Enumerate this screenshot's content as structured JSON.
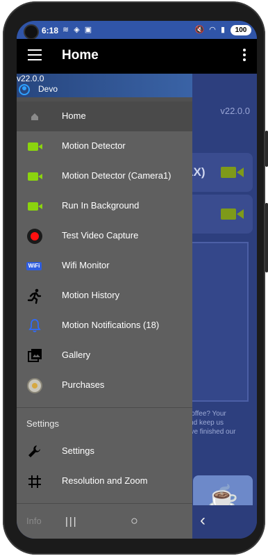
{
  "status_bar": {
    "time": "6:18",
    "left_icons": "≋ ◈ ▣",
    "right_icons": "🔇 ◠ ▮",
    "battery": "100"
  },
  "app_bar": {
    "title": "Home",
    "menu_icon": "hamburger-menu-icon",
    "overflow_icon": "more-vertical-icon"
  },
  "drawer": {
    "version": "v22.0.0",
    "user": "Devo",
    "active_item": "Home",
    "items": [
      {
        "label": "Home",
        "icon": "home-icon"
      },
      {
        "label": "Motion Detector",
        "icon": "video-camera-icon"
      },
      {
        "label": "Motion Detector (Camera1)",
        "icon": "video-camera-icon"
      },
      {
        "label": "Run In Background",
        "icon": "video-camera-icon"
      },
      {
        "label": "Test Video Capture",
        "icon": "record-icon"
      },
      {
        "label": "Wifi Monitor",
        "icon": "wifi-badge-icon"
      },
      {
        "label": "Motion History",
        "icon": "running-person-icon"
      },
      {
        "label": "Motion Notifications (18)",
        "icon": "bell-icon"
      },
      {
        "label": "Gallery",
        "icon": "gallery-icon"
      },
      {
        "label": "Purchases",
        "icon": "coin-icon"
      }
    ],
    "settings_header": "Settings",
    "settings_items": [
      {
        "label": "Settings",
        "icon": "wrench-icon"
      },
      {
        "label": "Resolution and Zoom",
        "icon": "grid-icon"
      }
    ],
    "info_header": "Info"
  },
  "background_app": {
    "version": "v22.0.0",
    "card_text": "RAX)",
    "promo_lines": [
      ")",
      "a coffee? Your",
      ", and keep us",
      "ve've finished our"
    ]
  },
  "nav_bar": {
    "recents": "|||",
    "home": "○",
    "back": "‹"
  },
  "colors": {
    "drawer_bg": "#5f5f5f",
    "app_bar": "#000000",
    "accent_green": "#8bd40e",
    "bell_blue": "#2e6bff",
    "background_app": "#2d3f7e"
  }
}
